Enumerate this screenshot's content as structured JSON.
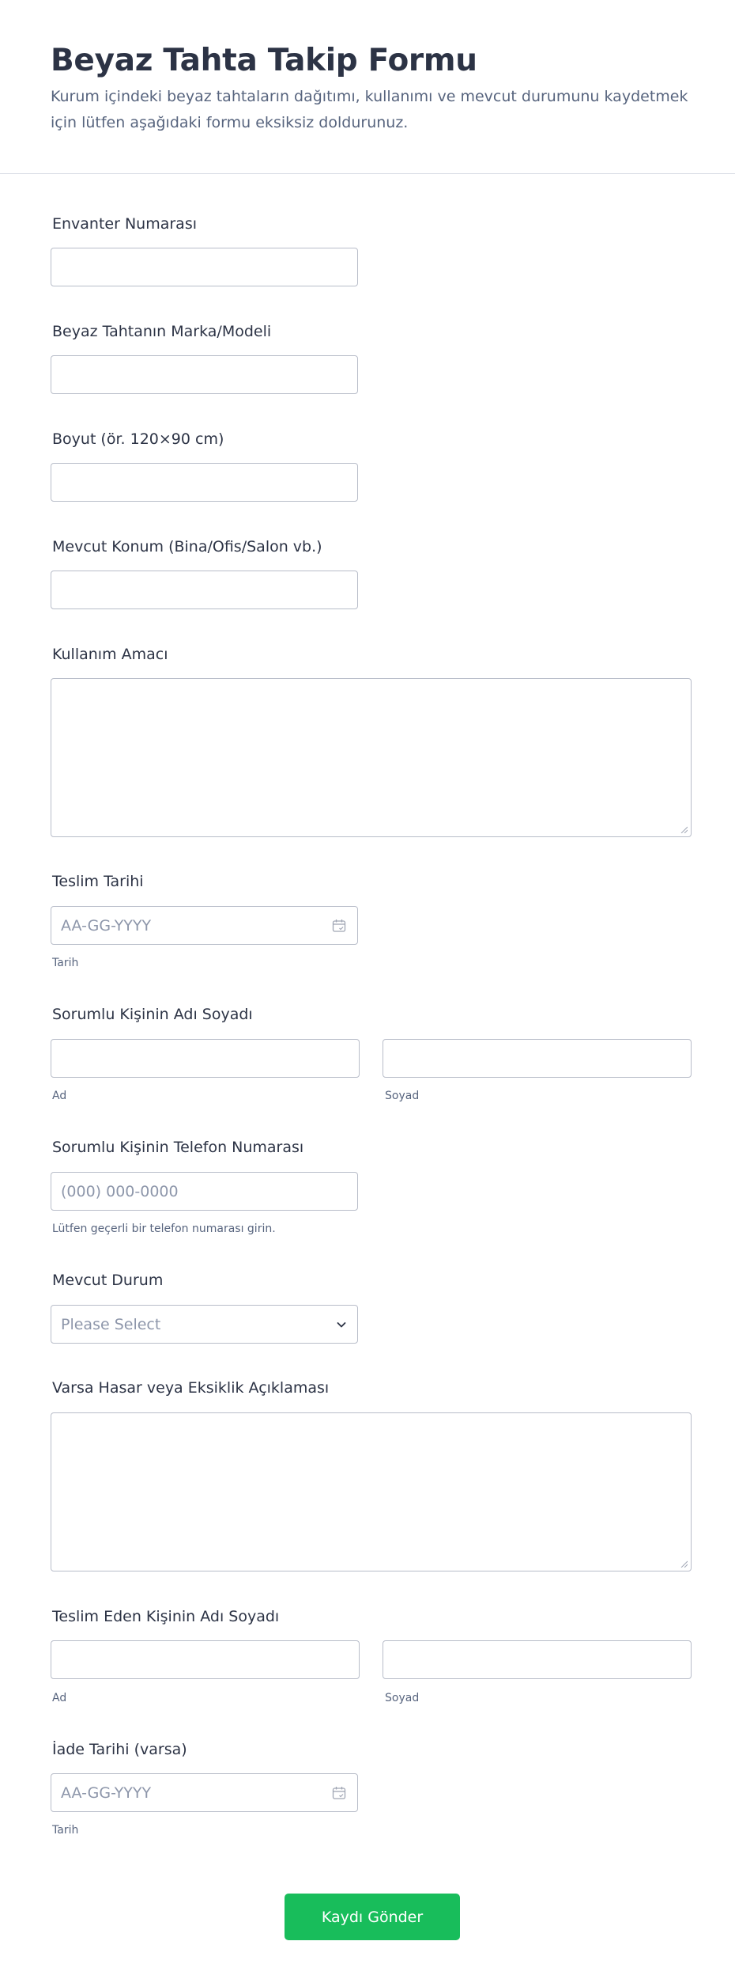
{
  "header": {
    "title": "Beyaz Tahta Takip Formu",
    "subtitle": "Kurum içindeki beyaz tahtaların dağıtımı, kullanımı ve mevcut durumunu kaydetmek için lütfen aşağıdaki formu eksiksiz doldurunuz."
  },
  "fields": {
    "inventory": {
      "label": "Envanter Numarası",
      "value": ""
    },
    "brand": {
      "label": "Beyaz Tahtanın Marka/Modeli",
      "value": ""
    },
    "size": {
      "label": "Boyut (ör. 120×90 cm)",
      "value": ""
    },
    "location": {
      "label": "Mevcut Konum (Bina/Ofis/Salon vb.)",
      "value": ""
    },
    "purpose": {
      "label": "Kullanım Amacı",
      "value": ""
    },
    "delivery_date": {
      "label": "Teslim Tarihi",
      "placeholder": "AA-GG-YYYY",
      "sublabel": "Tarih",
      "icon": "calendar-icon"
    },
    "responsible_name": {
      "label": "Sorumlu Kişinin Adı Soyadı",
      "first_sublabel": "Ad",
      "last_sublabel": "Soyad"
    },
    "responsible_phone": {
      "label": "Sorumlu Kişinin Telefon Numarası",
      "placeholder": "(000) 000-0000",
      "sublabel": "Lütfen geçerli bir telefon numarası girin."
    },
    "status": {
      "label": "Mevcut Durum",
      "selected": "Please Select",
      "icon": "chevron-down-icon"
    },
    "damage": {
      "label": "Varsa Hasar veya Eksiklik Açıklaması",
      "value": ""
    },
    "deliverer_name": {
      "label": "Teslim Eden Kişinin Adı Soyadı",
      "first_sublabel": "Ad",
      "last_sublabel": "Soyad"
    },
    "return_date": {
      "label": "İade Tarihi (varsa)",
      "placeholder": "AA-GG-YYYY",
      "sublabel": "Tarih",
      "icon": "calendar-icon"
    }
  },
  "submit": {
    "label": "Kaydı Gönder",
    "color": "#18bd5b"
  },
  "colors": {
    "text": "#2c3345",
    "muted": "#57647e",
    "placeholder": "#8d96aa",
    "border": "#b8bdc9"
  }
}
